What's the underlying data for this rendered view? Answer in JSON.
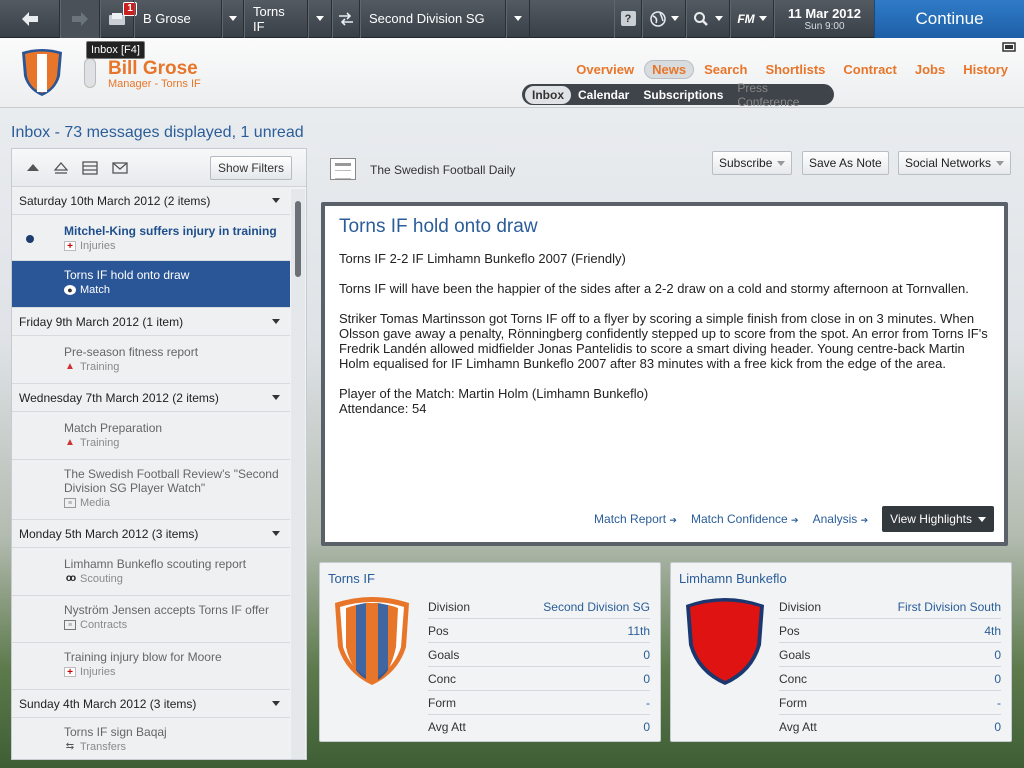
{
  "topbar": {
    "manager_name": "B Grose",
    "club": "Torns IF",
    "competition": "Second Division SG",
    "inbox_badge": "1",
    "help_label": "?",
    "fm_label": "FM",
    "date": "11 Mar 2012",
    "time": "Sun 9:00",
    "continue_label": "Continue"
  },
  "tooltip": "Inbox [F4]",
  "header": {
    "name": "Bill Grose",
    "role": "Manager - Torns IF",
    "nav": [
      "Overview",
      "News",
      "Search",
      "Shortlists",
      "Contract",
      "Jobs",
      "History"
    ],
    "subnav": [
      "Inbox",
      "Calendar",
      "Subscriptions",
      "Press Conference"
    ]
  },
  "page_title": "Inbox - 73 messages displayed, 1 unread",
  "list": {
    "show_filters": "Show Filters",
    "groups": [
      {
        "label": "Saturday 10th March 2012 (2 items)"
      },
      {
        "label": "Friday 9th March 2012 (1 item)"
      },
      {
        "label": "Wednesday 7th March 2012 (2 items)"
      },
      {
        "label": "Monday 5th March 2012 (3 items)"
      },
      {
        "label": "Sunday 4th March 2012 (3 items)"
      }
    ],
    "messages": [
      {
        "title": "Mitchel-King suffers injury in training",
        "cat": "Injuries",
        "icon": "injury-icon",
        "unread": true
      },
      {
        "title": "Torns IF hold onto draw",
        "cat": "Match",
        "icon": "football-icon",
        "selected": true
      },
      {
        "title": "Pre-season fitness report",
        "cat": "Training",
        "icon": "training-icon"
      },
      {
        "title": "Match Preparation",
        "cat": "Training",
        "icon": "training-icon"
      },
      {
        "title": "The Swedish Football Review's \"Second Division SG Player Watch\"",
        "cat": "Media",
        "icon": "media-icon"
      },
      {
        "title": "Limhamn Bunkeflo scouting report",
        "cat": "Scouting",
        "icon": "binoculars-icon"
      },
      {
        "title": "Nyström Jensen accepts Torns IF offer",
        "cat": "Contracts",
        "icon": "contract-icon"
      },
      {
        "title": "Training injury blow for Moore",
        "cat": "Injuries",
        "icon": "injury-icon"
      },
      {
        "title": "Torns IF sign Baqaj",
        "cat": "Transfers",
        "icon": "transfer-icon"
      }
    ]
  },
  "news": {
    "paper": "The Swedish Football Daily",
    "buttons": [
      "Subscribe",
      "Save As Note",
      "Social Networks"
    ],
    "headline": "Torns IF hold onto draw",
    "paragraphs": [
      "Torns IF 2-2 IF Limhamn Bunkeflo 2007 (Friendly)",
      "Torns IF will have been the happier of the sides after a 2-2 draw on a cold and stormy afternoon at Tornvallen.",
      "Striker Tomas Martinsson got Torns IF off to a flyer by scoring a simple finish from close in on 3 minutes. When Olsson gave away a penalty, Rönningberg confidently stepped up to score from the spot. An error from Torns IF's Fredrik Landén allowed midfielder Jonas Pantelidis to score a smart diving header. Young centre-back Martin Holm equalised for IF Limhamn Bunkeflo 2007 after 83 minutes with a free kick from the edge of the area.",
      "Player of the Match: Martin Holm (Limhamn Bunkeflo)",
      "Attendance: 54"
    ],
    "links": [
      "Match Report",
      "Match Confidence",
      "Analysis"
    ],
    "view_highlights": "View Highlights"
  },
  "teams": [
    {
      "name": "Torns IF",
      "stats": [
        [
          "Division",
          "Second Division SG"
        ],
        [
          "Pos",
          "11th"
        ],
        [
          "Goals",
          "0"
        ],
        [
          "Conc",
          "0"
        ],
        [
          "Form",
          "-"
        ],
        [
          "Avg Att",
          "0"
        ]
      ],
      "colors": [
        "#e8762a",
        "#ffffff",
        "#2a5596"
      ]
    },
    {
      "name": "Limhamn Bunkeflo",
      "stats": [
        [
          "Division",
          "First Division South"
        ],
        [
          "Pos",
          "4th"
        ],
        [
          "Goals",
          "0"
        ],
        [
          "Conc",
          "0"
        ],
        [
          "Form",
          "-"
        ],
        [
          "Avg Att",
          "0"
        ]
      ],
      "colors": [
        "#e01313",
        "#1b3770"
      ]
    }
  ]
}
